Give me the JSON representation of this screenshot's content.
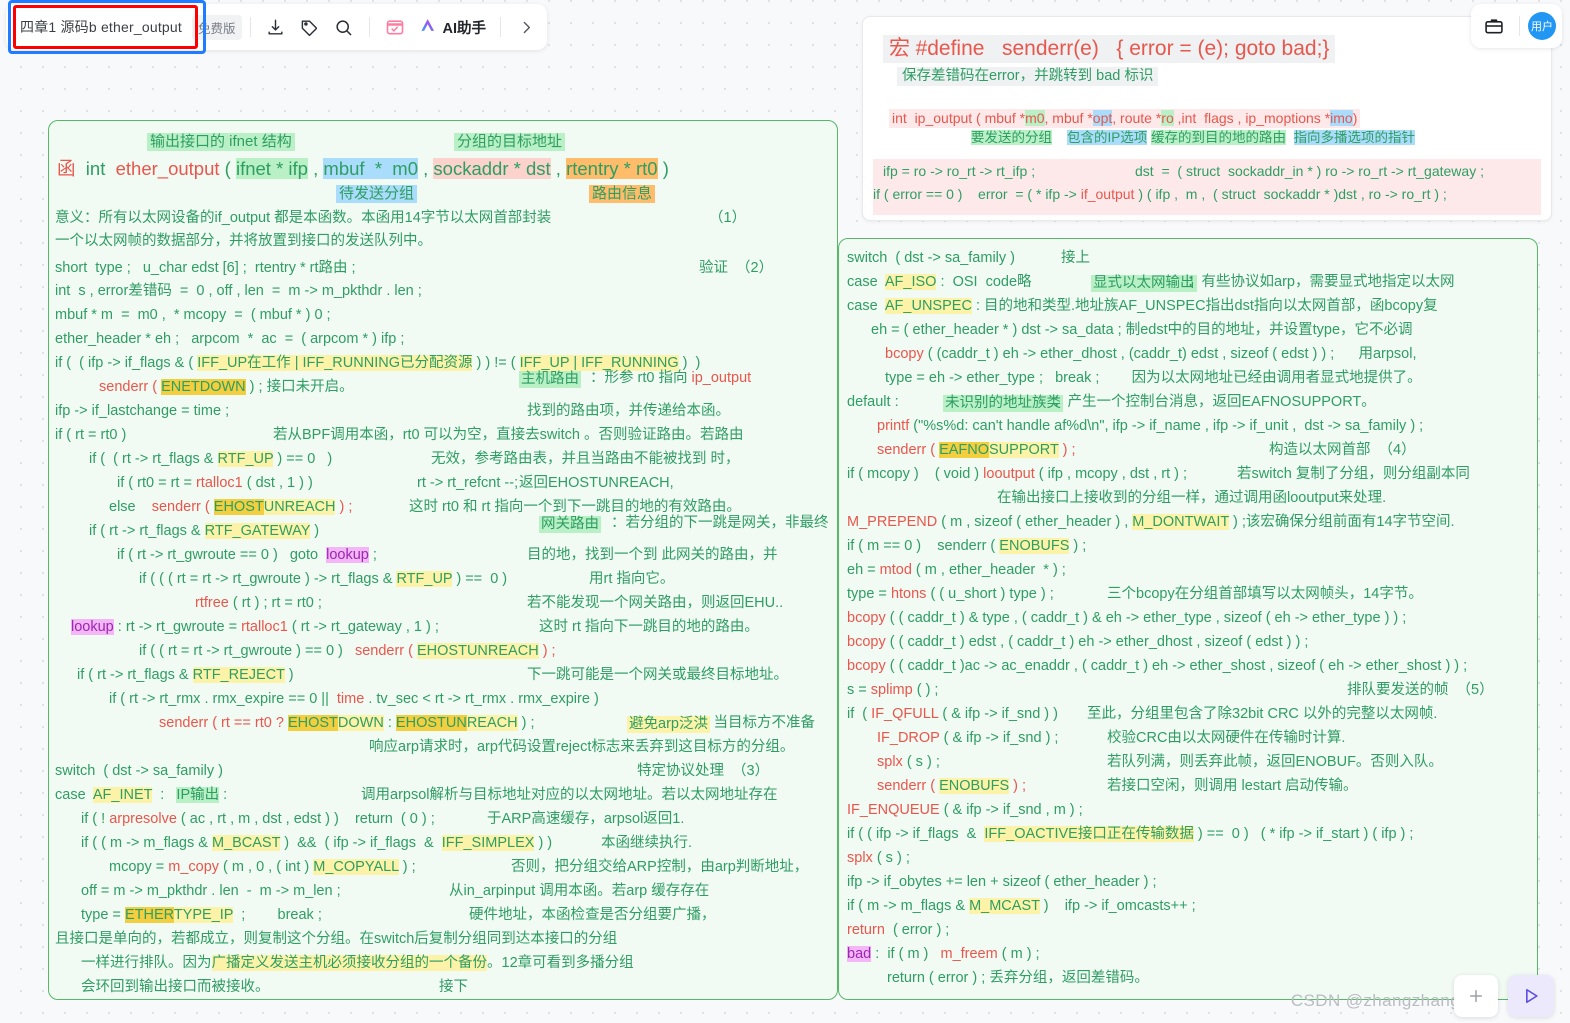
{
  "toolbar": {
    "doc_title": "四章1 源码b ether_output",
    "free_badge": "免费版",
    "download_icon": "download-icon",
    "tag_icon": "tag-icon",
    "search_icon": "search-icon",
    "calendar_icon": "calendar-icon",
    "ai_icon": "ai-sparkle-icon",
    "ai_label": "AI助手",
    "more_icon": "chevron-right-icon",
    "briefcase_icon": "briefcase-icon",
    "avatar_label": "用户"
  },
  "macro_card": {
    "title_macro": "宏",
    "title_define": "#define",
    "title_name": "senderr(e)",
    "title_body": "{ error = (e); goto bad;}",
    "subtitle": "保存差错码在error，并跳转到 bad 标识",
    "sig_pre": "int  ip_output ( mbuf *",
    "sig_m0": "m0",
    "sig_mid1": ", mbuf *",
    "sig_opt": "opt",
    "sig_mid2": ", route *",
    "sig_ro": "ro",
    "sig_mid3": " ,int  flags , ip_moptions *",
    "sig_imo": "imo",
    "sig_end": ")",
    "ann_m0": "要发送的分组",
    "ann_opt": "包含的IP选项",
    "ann_ro": "缓存的到目的地的路由",
    "ann_imo": "指向多播选项的指针",
    "line_ifp": "ifp = ro -> ro_rt -> rt_ifp ;",
    "line_dst": "dst  =  ( struct  sockaddr_in * ) ro -> ro_rt -> rt_gateway ;",
    "line_err_pre": "if ( error == 0 )    error  = ( * ifp -> ",
    "line_err_fn": "if_output",
    "line_err_post": " ) ( ifp ,  m ,  ( struct  sockaddr * )dst , ro -> ro_rt ) ;"
  },
  "left_card": {
    "ann_ifnet": "输出接口的 ifnet 结构",
    "ann_dst": "分组的目标地址",
    "sig_han": "函",
    "sig_int": "int",
    "sig_name": "ether_output",
    "sig_p1": "ifnet * ifp",
    "sig_p2": "mbuf  *  m0",
    "sig_p3": "sockaddr * dst",
    "sig_p4": "rtentry * rt0",
    "ann_m0": "待发送分组",
    "ann_rt0": "路由信息",
    "lines": [
      "意义：所有以太网设备的if_output 都是本函数。本函用14字节以太网首部封装",
      "一个以太网帧的数据部分，并将放置到接口的发送队列中。",
      "short  type ;   u_char edst [6] ;  rtentry * rt路由 ;",
      "int  s , error差错码  =  0 , off , len  =  m -> m_pkthdr . len ;",
      "mbuf * m  =  m0 ,  * mcopy  =  ( mbuf * ) 0 ;",
      "ether_header * eh ;   arpcom  *  ac  =  ( arpcom * ) ifp ;"
    ],
    "marks": {
      "m1": "（1）",
      "m2": "验证  （2）",
      "m3": "特定协议处理  （3）"
    },
    "code": {
      "l_if_flags_a": "if (  ( ifp -> if_flags & ( ",
      "l_iff_up": "IFF_UP在工作",
      "l_pipe": " | ",
      "l_iff_running": "IFF_RUNNING已分配资源",
      "l_if_flags_b": " ) ) != ( ",
      "l_iff_up2": "IFF_UP",
      "l_iff_running2": "IFF_RUNNING",
      "l_if_flags_c": " )  )",
      "l_senderr_enet_pre": "senderr ( ",
      "l_enet": "ENETDOWN",
      "l_senderr_enet_post": " ) ; 接口未开启。",
      "l_lastchange": "ifp -> if_lastchange = time ;",
      "l_rt_rt0": "if ( rt = rt0 )",
      "l_rtf_up_pre": "if (  ( rt -> rt_flags & ",
      "l_rtf_up": "RTF_UP",
      "l_rtf_up_post": " ) == 0   )",
      "l_rtalloc1": "if ( rt0 = rt = rtalloc1 ( dst , 1 ) )",
      "l_refcnt": "rt -> rt_refcnt --;",
      "l_else_senderr_pre": "else     senderr ( ",
      "l_ehu": "EHOSTUNREACH",
      "l_else_senderr_post": " ) ;",
      "l_gw_pre": "if ( rt -> rt_flags & ",
      "l_rtf_gw": "RTF_GATEWAY",
      "l_gw_post": " )",
      "l_gwroute0": "if ( rt -> rt_gwroute == 0 )   goto  ",
      "l_lookup": "lookup",
      "l_semicolon": " ;",
      "l_gwroute_up_pre": "if ( ( ( rt = rt -> rt_gwroute ) -> rt_flags & ",
      "l_rtf_up3": "RTF_UP",
      "l_gwroute_up_post": " ) ==  0 )",
      "l_rtfree": "rtfree ( rt ) ; rt = rt0 ;",
      "l_lookup_lbl": "lookup",
      "l_lookup_body": " : rt -> rt_gwroute = rtalloc1 ( rt -> rt_gateway , 1 ) ;",
      "l_gwroute_null_pre": "if ( ( rt = rt -> rt_gwroute ) == 0 )    senderr ( ",
      "l_ehu2": "EHOSTUNREACH",
      "l_gwroute_null_post": " ) ;",
      "l_reject_pre": "if ( rt -> rt_flags & ",
      "l_rtf_reject": "RTF_REJECT",
      "l_reject_post": " )",
      "l_expire": "if ( rt -> rt_rmx . rmx_expire == 0 ||   time . tv_sec < rt -> rt_rmx . rmx_expire )",
      "l_senderr_rt_pre": "senderr ( rt == rt0 ? ",
      "l_ehostdown": "EHOSTDOWN",
      "l_colon": " : ",
      "l_ehu3": "EHOSTUNREACH",
      "l_senderr_rt_post": " ) ;",
      "l_switch": "switch  ( dst -> sa_family )",
      "l_case_pre": "case  ",
      "l_af_inet": "AF_INET",
      "l_case_mid": "  :   ",
      "l_ipout": "IP输出",
      "l_case_post": " :",
      "l_arpresolve": "if ( ! arpresolve ( ac , rt , m , dst , edst ) )    return  ( 0 ) ;",
      "l_bcast_pre": "if ( ( m -> m_flags & ",
      "l_mbcast": "M_BCAST",
      "l_bcast_mid": " )  &&  ( ifp -> if_flags  &  ",
      "l_simplex": "IFF_SIMPLEX",
      "l_bcast_post": " ) )",
      "l_mcopy_pre": "mcopy = ",
      "l_mcopy_fn": "m_copy",
      "l_mcopy_mid": " ( m , 0 , ( int ) ",
      "l_copyall": "M_COPYALL",
      "l_mcopy_post": " ) ;",
      "l_off": "off = m -> m_pkthdr . len  -  m -> m_len ;",
      "l_type_pre": "type = ",
      "l_ethertype": "ETHERTYPE_IP",
      "l_type_post": "  ;        break ;"
    },
    "notes": {
      "n_host_route_hl": "主机路由",
      "n_host_route": "：形参 rt0 指向 ",
      "n_ip_output": "ip_output",
      "n_host_route2": "找到的路由项，并传递给本函。",
      "n_bpf": "若从BPF调用本函，rt0 可以为空，直接去switch 。否则验证路由。若路由",
      "n_invalid": "无效，参考路由表，并且当路由不能被找到 时，",
      "n_ehu_ret": "返回EHOSTUNREACH,",
      "n_valid": "这时 rt0 和 rt 指向一个到下一跳目的地的有效路由。",
      "n_gw_hl": "网关路由",
      "n_gw": "：若分组的下一跳是网关，非最终",
      "n_gw2": "目的地，找到一个到 此网关的路由，并",
      "n_gw3": "用rt 指向它。",
      "n_gw4": "若不能发现一个网关路由，则返回EHU..",
      "n_gw5": "这时 rt 指向下一跳目的地的路由。",
      "n_reject": "下一跳可能是一个网关或最终目标地址。",
      "n_arp_hl": "避免arp泛洪",
      "n_arp": "：当目标方不准备",
      "n_arp2": "响应arp请求时，arp代码设置reject标志来丢弃到这目标方的分组。",
      "n_arpsol": "调用arpsol解析与目标地址对应的以太网地址。若以太网地址存在",
      "n_arpsol2": "于ARP高速缓存，arpsol返回1.",
      "n_arpsol3": "本函继续执行.",
      "n_arpsol4": "否则，把分组交给ARP控制，由arp判断地址，",
      "n_arpsol5": "从in_arpinput 调用本函。若arp 缓存存在",
      "n_arpsol6": "硬件地址，本函检查是否分组要广播，",
      "n_last1": "且接口是单向的，若都成立，则复制这个分组。在switch后复制分组同到达本接口的分组",
      "n_last2_pre": "一样进行排队。因为",
      "n_last2_hl": "广播定义发送主机必须接收分组的一个备份",
      "n_last2_post": "。12章可看到多播分组",
      "n_last3": "会环回到输出接口而被接收。",
      "n_last4": "接下"
    }
  },
  "right_card": {
    "l_switch": "switch  ( dst -> sa_family )",
    "n_jieshang": "接上",
    "l_case_iso_pre": "case  ",
    "l_af_iso": "AF_ISO",
    "l_case_iso_post": " :  OSI  code略",
    "n_explicit_hl": "显式以太网输出",
    "n_explicit": "：有些协议如arp，需要显式地指定以太网",
    "l_case_unspec_pre": "case  ",
    "l_af_unspec": "AF_UNSPEC",
    "l_case_unspec_post": " : 目的地和类型.地址族AF_UNSPEC指出dst指向以太网首部，函bcopy复",
    "l_eh": "eh = ( ether_header * ) dst -> sa_data ; 制edst中的目的地址，并设置type，它不必调",
    "l_bcopy1_fn": "bcopy",
    "l_bcopy1": " ( (caddr_t ) eh -> ether_dhost , (caddr_t) edst , sizeof ( edst ) ) ;      用arpsol,",
    "l_type_break": "type = eh -> ether_type ;   break ;        因为以太网地址已经由调用者显式地提供了。",
    "l_default": "default :",
    "n_unknown_hl": "未识别的地址族类",
    "n_unknown": "：产生一个控制台消息，返回EAFNOSUPPORT。",
    "l_printf_fn": "printf",
    "l_printf": " (\"%s%d: can't handle af%d\\n\", ifp -> if_name , ifp -> if_unit ,  dst -> sa_family ) ;",
    "l_senderr_eaf_pre": "senderr ( ",
    "l_eaf": "EAFNOSUPPORT",
    "l_senderr_eaf_post": " ) ;",
    "l_mcopy_pre": "if ( mcopy )    ( void ) ",
    "l_looutput": "looutput",
    "l_mcopy_post": " ( ifp , mcopy , dst , rt ) ;",
    "n_mcopy": "若switch 复制了分组，则分组副本同",
    "n_mcopy2": "在输出接口上接收到的分组一样，通过调用函looutput来处理.",
    "l_prepend_fn": "M_PREPEND",
    "l_prepend": " ( m , sizeof ( ether_header ) , ",
    "l_dontwait": "M_DONTWAIT",
    "l_prepend_post": " ) ;",
    "n_prepend": "该宏确保分组前面有14字节空间.",
    "l_menobufs_pre": "if ( m == 0 )    senderr ( ",
    "l_enobufs": "ENOBUFS",
    "l_menobufs_post": " ) ;",
    "l_mtod_pre": "eh = ",
    "l_mtod": "mtod",
    "l_mtod_post": " ( m , ether_header  * ) ;",
    "l_type_pre": "type = ",
    "l_htons": "htons",
    "l_type_post": " ( ( u_short ) type ) ;",
    "n_three_bcopy": "三个bcopy在分组首部填写以太网帧头，14字节。",
    "l_bcopy2_fn": "bcopy",
    "l_bcopy2": " ( ( caddr_t ) & type , ( caddr_t ) & eh -> ether_type , sizeof ( eh -> ether_type ) ) ;",
    "l_bcopy3_fn": "bcopy",
    "l_bcopy3": " ( ( caddr_t ) edst , ( caddr_t ) eh -> ether_dhost , sizeof ( edst ) ) ;",
    "l_bcopy4_fn": "bcopy",
    "l_bcopy4": " ( ( caddr_t )ac -> ac_enaddr , ( caddr_t ) eh -> ether_shost , sizeof ( eh -> ether_shost ) ) ;",
    "l_splimp_pre": "s = ",
    "l_splimp": "splimp",
    "l_splimp_post": " ( ) ;",
    "n_queue_mark": "排队要发送的帧  （5）",
    "l_qfull_pre": "if  ( ",
    "l_if_qfull": "IF_QFULL",
    "l_qfull_post": " ( & ifp -> if_snd ) )",
    "n_qfull": "至此，分组里包含了除32bit CRC 以外的完整以太网帧.",
    "l_ifdrop_fn": "IF_DROP",
    "l_ifdrop": " ( & ifp -> if_snd ) ;",
    "n_crc": "校验CRC由以太网硬件在传输时计算.",
    "l_splx1_fn": "splx",
    "l_splx1": " ( s ) ;",
    "n_full": "若队列满，则丢弃此帧，返回ENOBUF。否则入队。",
    "l_senderr_eno_pre": "senderr ( ",
    "l_enobufs2": "ENOBUFS",
    "l_senderr_eno_post": " ) ;",
    "n_idle": "若接口空闲，则调用 lestart 启动传输。",
    "l_enqueue_fn": "IF_ENQUEUE",
    "l_enqueue": " ( & ifp -> if_snd , m ) ;",
    "l_oactive_pre": "if ( ( ifp -> if_flags  &  ",
    "l_oactive": "IFF_OACTIVE接口正在传输数据",
    "l_oactive_post": " ) ==  0 )   ( * ifp -> if_start ) ( ifp ) ;",
    "l_splx2_fn": "splx",
    "l_splx2": " ( s ) ;",
    "l_obytes": "ifp -> if_obytes += len + sizeof ( ether_header ) ;",
    "l_mcast_pre": "if ( m -> m_flags & ",
    "l_mcast": "M_MCAST",
    "l_mcast_post": " )    ifp -> if_omcasts++ ;",
    "l_return1_kw": "return",
    "l_return1": "  ( error ) ;",
    "l_bad": "bad",
    "l_bad_rest": " :  if ( m )   ",
    "l_mfreem": "m_freem",
    "l_mfreem_post": " ( m ) ;",
    "l_return2": "return ( error ) ; 丢弃分组，返回差错码。",
    "mark4": "构造以太网首部  （4）"
  },
  "watermark": "CSDN @zhangzhangKeji",
  "colors": {
    "accent_green": "#2e9e63",
    "accent_red": "#e8574c",
    "card_border": "#57b868",
    "card_bg": "#f2faf4",
    "blue_outline": "#1f7bff",
    "red_outline": "#ff0000"
  }
}
